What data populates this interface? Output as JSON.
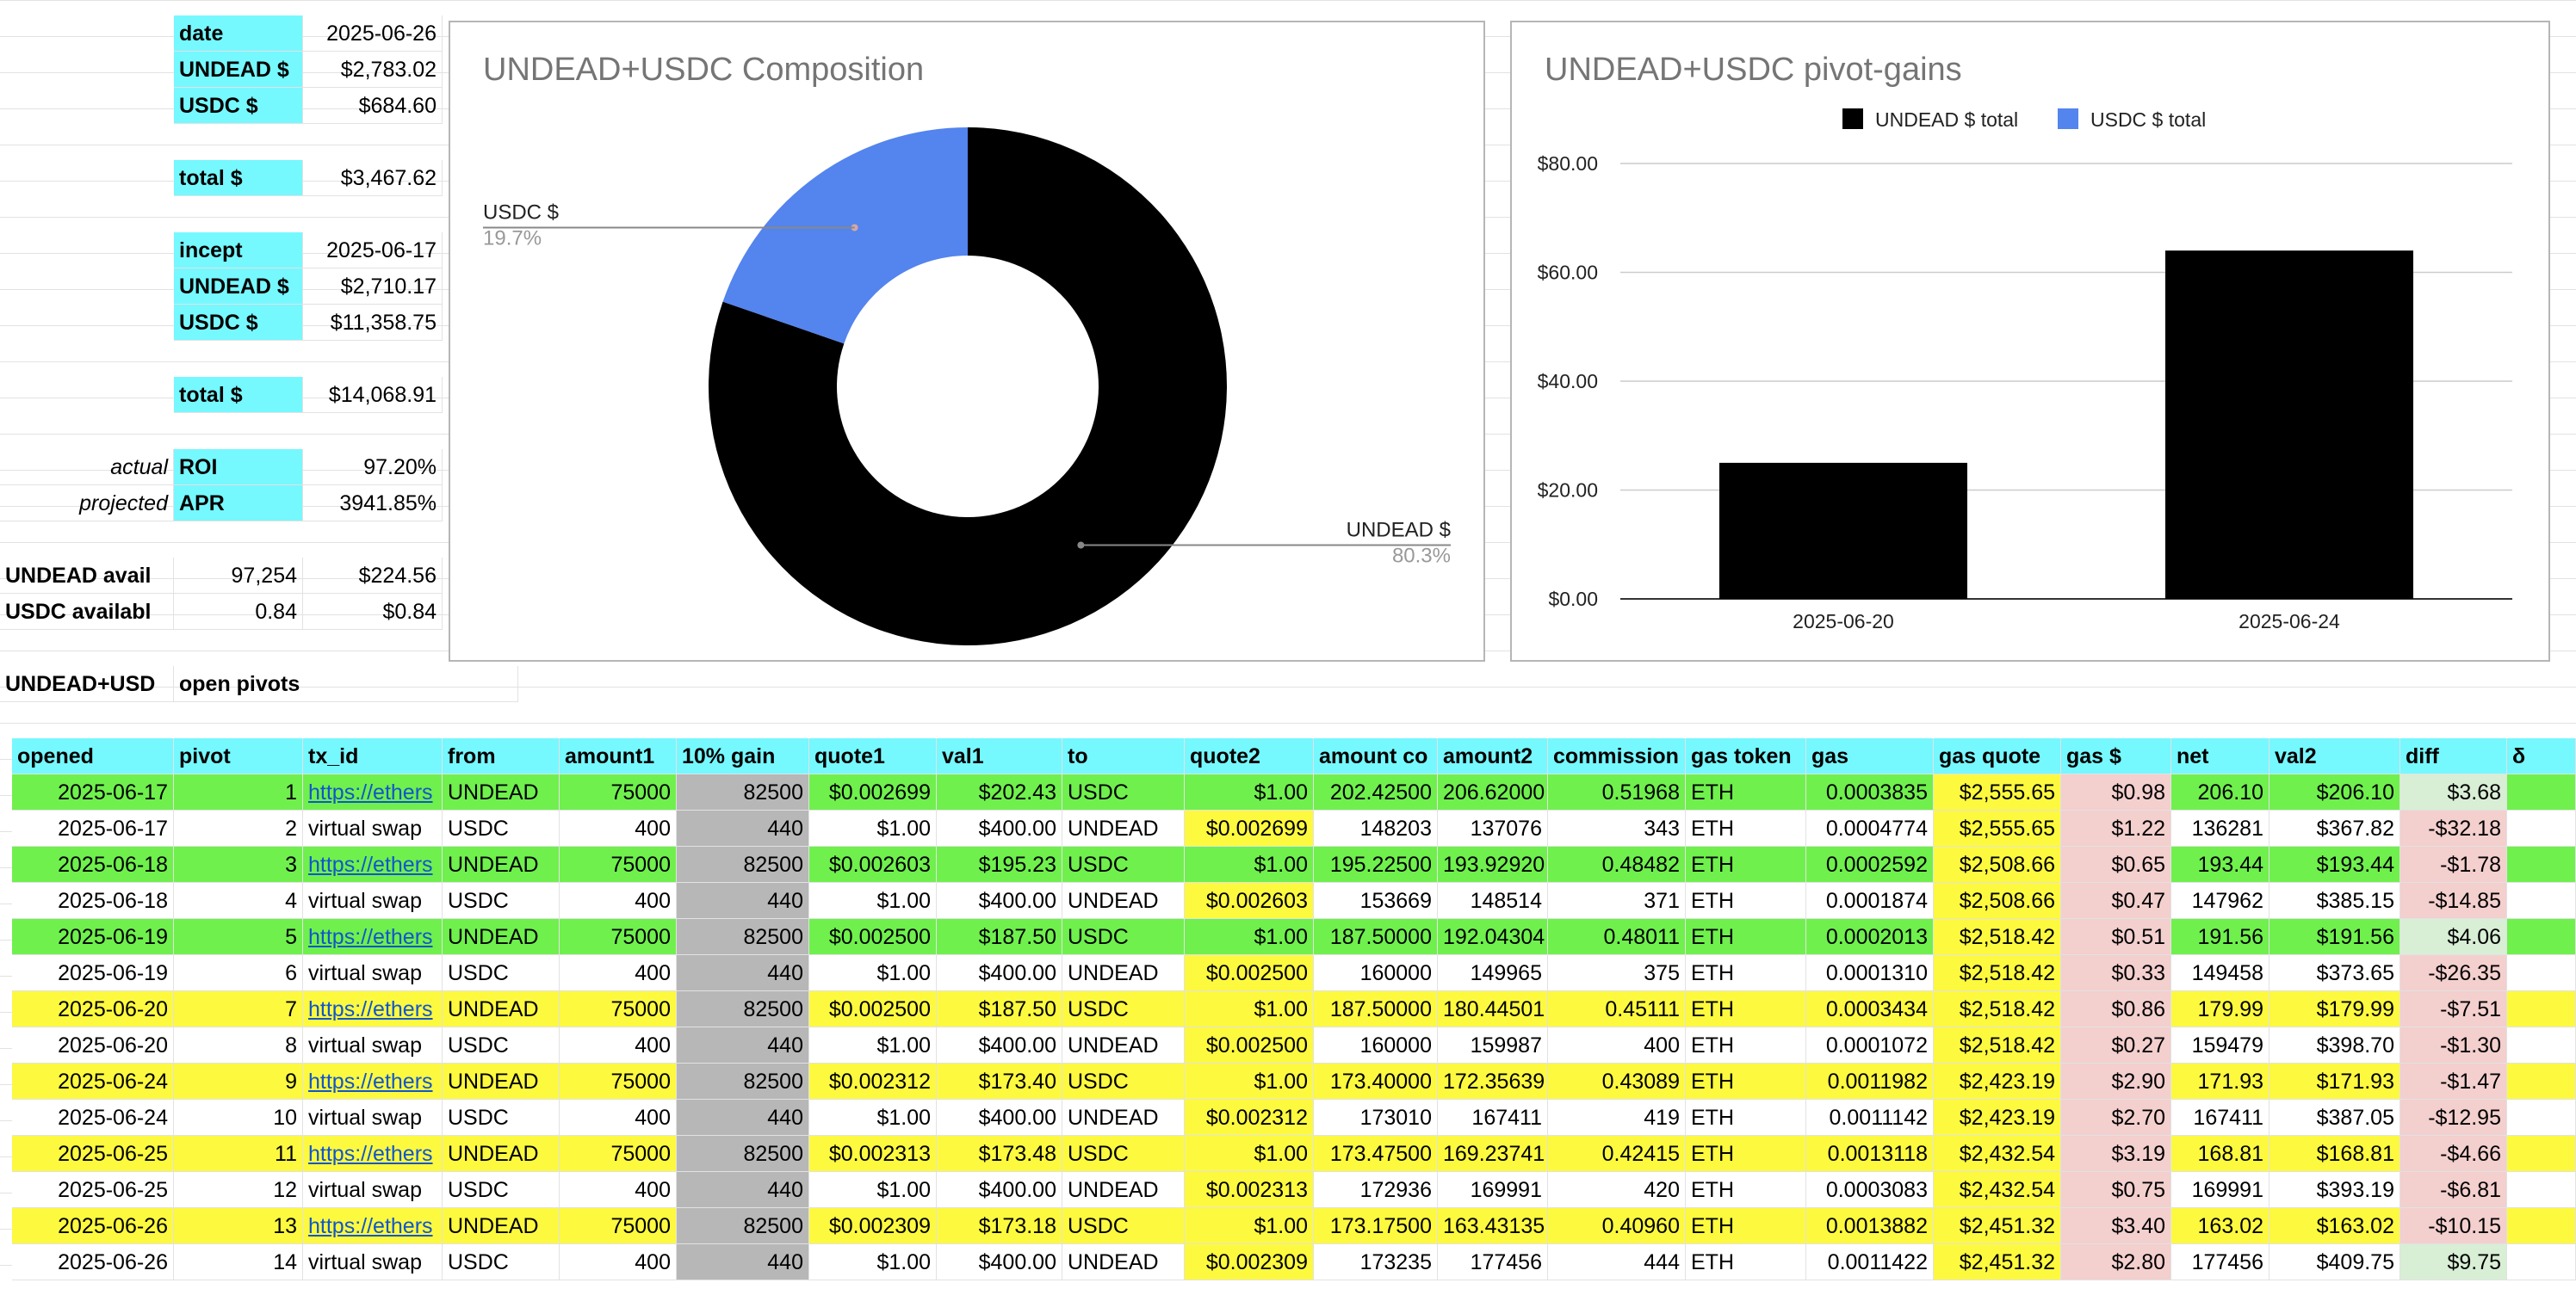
{
  "summary": {
    "date_label": "date",
    "date_value": "2025-06-26",
    "undead_label": "UNDEAD $",
    "undead_value": "$2,783.02",
    "usdc_label": "USDC $",
    "usdc_value": "$684.60",
    "total_label": "total $",
    "total_value": "$3,467.62",
    "incept_label": "incept",
    "incept_value": "2025-06-17",
    "incept_undead_label": "UNDEAD $",
    "incept_undead_value": "$2,710.17",
    "incept_usdc_label": "USDC $",
    "incept_usdc_value": "$11,358.75",
    "incept_total_label": "total $",
    "incept_total_value": "$14,068.91",
    "actual_label": "actual",
    "roi_label": "ROI",
    "roi_value": "97.20%",
    "projected_label": "projected",
    "apr_label": "APR",
    "apr_value": "3941.85%",
    "undead_avail_label": "UNDEAD avail",
    "undead_avail_qty": "97,254",
    "undead_avail_usd": "$224.56",
    "usdc_avail_label": "USDC availabl",
    "usdc_avail_qty": "0.84",
    "usdc_avail_usd": "$0.84"
  },
  "pivots_title_a": "UNDEAD+USD",
  "pivots_title_b": "open pivots",
  "table": {
    "headers": [
      "opened",
      "pivot",
      "tx_id",
      "from",
      "amount1",
      "10% gain",
      "quote1",
      "val1",
      "to",
      "quote2",
      "amount co",
      "amount2",
      "commission",
      "gas token",
      "gas",
      "gas quote",
      "gas $",
      "net",
      "val2",
      "diff",
      "δ"
    ],
    "rows": [
      [
        "2025-06-17",
        "1",
        "https://ethers",
        "UNDEAD",
        "75000",
        "82500",
        "$0.002699",
        "$202.43",
        "USDC",
        "$1.00",
        "202.42500",
        "206.62000",
        "0.51968",
        "ETH",
        "0.0003835",
        "$2,555.65",
        "$0.98",
        "206.10",
        "$206.10",
        "$3.68"
      ],
      [
        "2025-06-17",
        "2",
        "virtual swap",
        "USDC",
        "400",
        "440",
        "$1.00",
        "$400.00",
        "UNDEAD",
        "$0.002699",
        "148203",
        "137076",
        "343",
        "ETH",
        "0.0004774",
        "$2,555.65",
        "$1.22",
        "136281",
        "$367.82",
        "-$32.18"
      ],
      [
        "2025-06-18",
        "3",
        "https://ethers",
        "UNDEAD",
        "75000",
        "82500",
        "$0.002603",
        "$195.23",
        "USDC",
        "$1.00",
        "195.22500",
        "193.92920",
        "0.48482",
        "ETH",
        "0.0002592",
        "$2,508.66",
        "$0.65",
        "193.44",
        "$193.44",
        "-$1.78"
      ],
      [
        "2025-06-18",
        "4",
        "virtual swap",
        "USDC",
        "400",
        "440",
        "$1.00",
        "$400.00",
        "UNDEAD",
        "$0.002603",
        "153669",
        "148514",
        "371",
        "ETH",
        "0.0001874",
        "$2,508.66",
        "$0.47",
        "147962",
        "$385.15",
        "-$14.85"
      ],
      [
        "2025-06-19",
        "5",
        "https://ethers",
        "UNDEAD",
        "75000",
        "82500",
        "$0.002500",
        "$187.50",
        "USDC",
        "$1.00",
        "187.50000",
        "192.04304",
        "0.48011",
        "ETH",
        "0.0002013",
        "$2,518.42",
        "$0.51",
        "191.56",
        "$191.56",
        "$4.06"
      ],
      [
        "2025-06-19",
        "6",
        "virtual swap",
        "USDC",
        "400",
        "440",
        "$1.00",
        "$400.00",
        "UNDEAD",
        "$0.002500",
        "160000",
        "149965",
        "375",
        "ETH",
        "0.0001310",
        "$2,518.42",
        "$0.33",
        "149458",
        "$373.65",
        "-$26.35"
      ],
      [
        "2025-06-20",
        "7",
        "https://ethers",
        "UNDEAD",
        "75000",
        "82500",
        "$0.002500",
        "$187.50",
        "USDC",
        "$1.00",
        "187.50000",
        "180.44501",
        "0.45111",
        "ETH",
        "0.0003434",
        "$2,518.42",
        "$0.86",
        "179.99",
        "$179.99",
        "-$7.51"
      ],
      [
        "2025-06-20",
        "8",
        "virtual swap",
        "USDC",
        "400",
        "440",
        "$1.00",
        "$400.00",
        "UNDEAD",
        "$0.002500",
        "160000",
        "159987",
        "400",
        "ETH",
        "0.0001072",
        "$2,518.42",
        "$0.27",
        "159479",
        "$398.70",
        "-$1.30"
      ],
      [
        "2025-06-24",
        "9",
        "https://ethers",
        "UNDEAD",
        "75000",
        "82500",
        "$0.002312",
        "$173.40",
        "USDC",
        "$1.00",
        "173.40000",
        "172.35639",
        "0.43089",
        "ETH",
        "0.0011982",
        "$2,423.19",
        "$2.90",
        "171.93",
        "$171.93",
        "-$1.47"
      ],
      [
        "2025-06-24",
        "10",
        "virtual swap",
        "USDC",
        "400",
        "440",
        "$1.00",
        "$400.00",
        "UNDEAD",
        "$0.002312",
        "173010",
        "167411",
        "419",
        "ETH",
        "0.0011142",
        "$2,423.19",
        "$2.70",
        "167411",
        "$387.05",
        "-$12.95"
      ],
      [
        "2025-06-25",
        "11",
        "https://ethers",
        "UNDEAD",
        "75000",
        "82500",
        "$0.002313",
        "$173.48",
        "USDC",
        "$1.00",
        "173.47500",
        "169.23741",
        "0.42415",
        "ETH",
        "0.0013118",
        "$2,432.54",
        "$3.19",
        "168.81",
        "$168.81",
        "-$4.66"
      ],
      [
        "2025-06-25",
        "12",
        "virtual swap",
        "USDC",
        "400",
        "440",
        "$1.00",
        "$400.00",
        "UNDEAD",
        "$0.002313",
        "172936",
        "169991",
        "420",
        "ETH",
        "0.0003083",
        "$2,432.54",
        "$0.75",
        "169991",
        "$393.19",
        "-$6.81"
      ],
      [
        "2025-06-26",
        "13",
        "https://ethers",
        "UNDEAD",
        "75000",
        "82500",
        "$0.002309",
        "$173.18",
        "USDC",
        "$1.00",
        "173.17500",
        "163.43135",
        "0.40960",
        "ETH",
        "0.0013882",
        "$2,451.32",
        "$3.40",
        "163.02",
        "$163.02",
        "-$10.15"
      ],
      [
        "2025-06-26",
        "14",
        "virtual swap",
        "USDC",
        "400",
        "440",
        "$1.00",
        "$400.00",
        "UNDEAD",
        "$0.002309",
        "173235",
        "177456",
        "444",
        "ETH",
        "0.0011422",
        "$2,451.32",
        "$2.80",
        "177456",
        "$409.75",
        "$9.75"
      ]
    ],
    "row_colors": [
      "#6ff04d",
      "#ffffff",
      "#6ff04d",
      "#ffffff",
      "#6ff04d",
      "#ffffff",
      "#fdf93f",
      "#ffffff",
      "#fdf93f",
      "#ffffff",
      "#fdf93f",
      "#ffffff",
      "#fdf93f",
      "#ffffff"
    ]
  },
  "chart_data": [
    {
      "type": "pie",
      "title": "UNDEAD+USDC Composition",
      "categories": [
        "UNDEAD $",
        "USDC $"
      ],
      "values": [
        80.3,
        19.7
      ],
      "percent_labels": [
        "80.3%",
        "19.7%"
      ],
      "colors": [
        "#000000",
        "#5484ed"
      ],
      "hole": 0.5
    },
    {
      "type": "bar",
      "title": "UNDEAD+USDC pivot-gains",
      "categories": [
        "2025-06-20",
        "2025-06-24"
      ],
      "series": [
        {
          "name": "UNDEAD $ total",
          "values": [
            25,
            64
          ],
          "color": "#000000"
        },
        {
          "name": "USDC $ total",
          "values": [
            0,
            0
          ],
          "color": "#5484ed"
        }
      ],
      "ylim": [
        0,
        80
      ],
      "yticks": [
        "$0.00",
        "$20.00",
        "$40.00",
        "$60.00",
        "$80.00"
      ],
      "legend": "top"
    }
  ]
}
